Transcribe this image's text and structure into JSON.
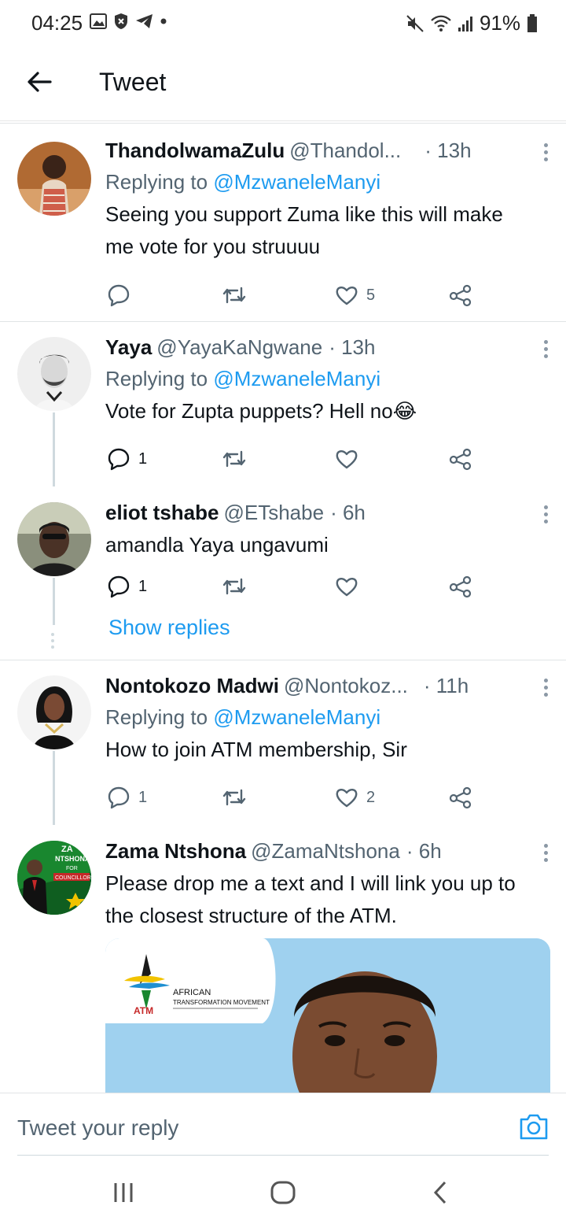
{
  "status_bar": {
    "time": "04:25",
    "battery": "91%"
  },
  "header": {
    "title": "Tweet"
  },
  "tweets": [
    {
      "name": "ThandolwamaZulu",
      "handle": "@Thandol...",
      "time": "· 13h",
      "replying_prefix": "Replying to ",
      "replying_to": "@MzwaneleManyi",
      "text": "Seeing you support Zuma like this will make me vote for you struuuu",
      "reply_count": "",
      "retweet_count": "",
      "like_count": "5"
    },
    {
      "name": "Yaya",
      "handle": "@YayaKaNgwane",
      "time": "· 13h",
      "replying_prefix": "Replying to ",
      "replying_to": "@MzwaneleManyi",
      "text": "Vote for Zupta puppets? Hell no😂",
      "reply_count": "1",
      "retweet_count": "",
      "like_count": ""
    },
    {
      "name": "eliot tshabe",
      "handle": "@ETshabe",
      "time": "· 6h",
      "text": "amandla Yaya ungavumi",
      "reply_count": "1",
      "retweet_count": "",
      "like_count": ""
    },
    {
      "name": "Nontokozo Madwi",
      "handle": "@Nontokoz...",
      "time": "· 11h",
      "replying_prefix": "Replying to ",
      "replying_to": "@MzwaneleManyi",
      "text": "How to join ATM membership, Sir",
      "reply_count": "1",
      "retweet_count": "",
      "like_count": "2"
    },
    {
      "name": "Zama Ntshona",
      "handle": "@ZamaNtshona",
      "time": "· 6h",
      "text": "Please drop me a text and I will link you up to the closest structure of the ATM."
    }
  ],
  "show_replies": "Show replies",
  "media": {
    "org_name": "AFRICAN",
    "org_name_2": "TRANSFORMATION MOVEMENT",
    "org_abbr": "ATM"
  },
  "avatar_zama": {
    "line1": "ZA",
    "line2": "NTSHONA",
    "line3": "FOR",
    "line4": "COUNCILLOR"
  },
  "composer": {
    "placeholder": "Tweet your reply"
  },
  "colors": {
    "accent": "#1d9bf0",
    "secondary_text": "#536471"
  }
}
